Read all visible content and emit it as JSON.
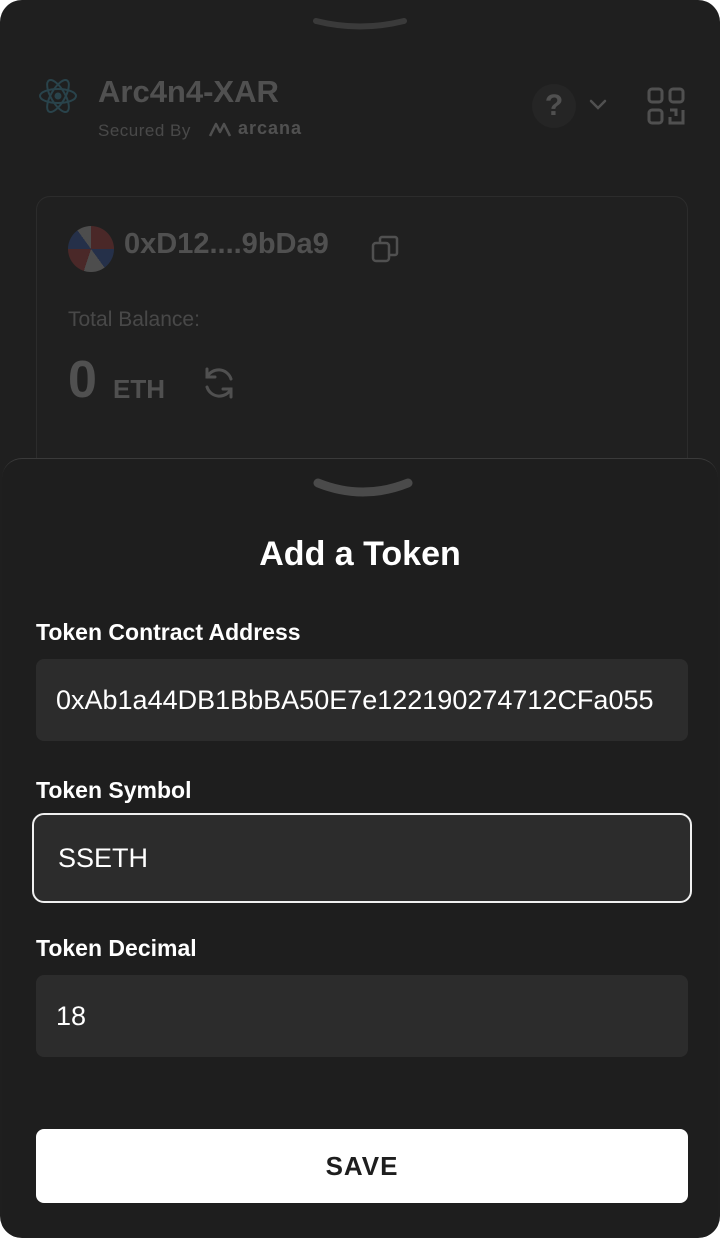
{
  "header": {
    "app_name": "Arc4n4-XAR",
    "secured_by": "Secured By",
    "brand": "arcana",
    "help_symbol": "?"
  },
  "account": {
    "address": "0xD12....9bDa9",
    "balance_label": "Total Balance:",
    "balance_value": "0",
    "balance_unit": "ETH"
  },
  "sheet": {
    "title": "Add a Token",
    "contract_label": "Token Contract Address",
    "contract_value": "0xAb1a44DB1BbBA50E7e122190274712CFa055",
    "symbol_label": "Token Symbol",
    "symbol_value": "SSETH",
    "decimal_label": "Token Decimal",
    "decimal_value": "18",
    "save_label": "SAVE"
  },
  "colors": {
    "background": "#1f1f1f",
    "sheet": "#1e1e1e",
    "field": "#2c2c2c",
    "button": "#ffffff",
    "text": "#ffffff"
  }
}
